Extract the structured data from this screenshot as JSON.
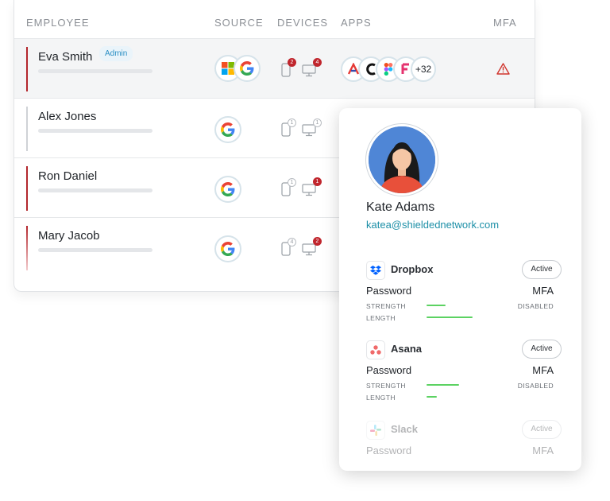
{
  "table": {
    "headers": {
      "employee": "EMPLOYEE",
      "source": "SOURCE",
      "devices": "DEVICES",
      "apps": "APPS",
      "mfa": "MFA"
    },
    "rows": [
      {
        "name": "Eva Smith",
        "badge": "Admin",
        "mobile_count": "2",
        "desktop_count": "4",
        "apps_more": "+32"
      },
      {
        "name": "Alex Jones",
        "mobile_count": "1",
        "desktop_count": "1"
      },
      {
        "name": "Ron Daniel",
        "mobile_count": "1",
        "desktop_count": "1"
      },
      {
        "name": "Mary Jacob",
        "mobile_count": "4",
        "desktop_count": "2"
      }
    ]
  },
  "profile": {
    "name": "Kate Adams",
    "email": "katea@shieldednetwork.com",
    "services": [
      {
        "name": "Dropbox",
        "status": "Active",
        "password_label": "Password",
        "strength_label": "STRENGTH",
        "length_label": "LENGTH",
        "mfa_label": "MFA",
        "mfa_value": "DISABLED",
        "strength": 0.3,
        "length": 0.75,
        "logo": "dropbox-icon"
      },
      {
        "name": "Asana",
        "status": "Active",
        "password_label": "Password",
        "strength_label": "STRENGTH",
        "length_label": "LENGTH",
        "mfa_label": "MFA",
        "mfa_value": "DISABLED",
        "strength": 0.55,
        "length": 0.18,
        "logo": "asana-icon"
      },
      {
        "name": "Slack",
        "status": "Active",
        "password_label": "Password",
        "mfa_label": "MFA",
        "logo": "slack-icon"
      }
    ]
  },
  "colors": {
    "accent_red": "#b3262c",
    "teal_link": "#1c8fa7",
    "strength_green": "#5cd262",
    "avatar_bg": "#4f86d6"
  }
}
